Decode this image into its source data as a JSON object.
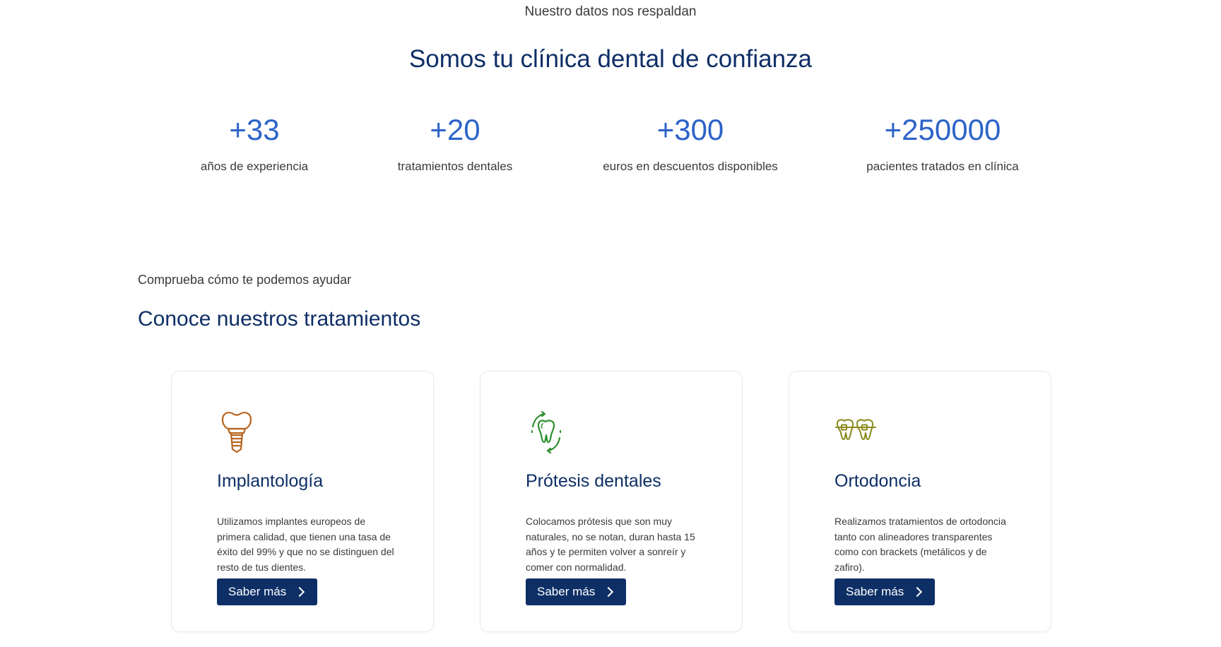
{
  "stats": {
    "eyebrow": "Nuestro datos nos respaldan",
    "title": "Somos tu clínica dental de confianza",
    "items": [
      {
        "value": "+33",
        "label": "años de experiencia"
      },
      {
        "value": "+20",
        "label": "tratamientos dentales"
      },
      {
        "value": "+300",
        "label": "euros en descuentos disponibles"
      },
      {
        "value": "+250000",
        "label": "pacientes tratados en clínica"
      }
    ]
  },
  "treatments": {
    "eyebrow": "Comprueba cómo te podemos ayudar",
    "title": "Conoce nuestros tratamientos",
    "cards": [
      {
        "icon": "dental-implant-icon",
        "icon_color": "#b8641e",
        "title": "Implantología",
        "description": "Utilizamos implantes europeos de primera calidad, que tienen una tasa de éxito del 99% y que no se distinguen del resto de tus dientes.",
        "button": "Saber más"
      },
      {
        "icon": "tooth-prosthesis-icon",
        "icon_color": "#2f8f2f",
        "title": "Prótesis dentales",
        "description": "Colocamos prótesis que son muy naturales, no se notan, duran hasta 15 años y te permiten volver a sonreír y comer con normalidad.",
        "button": "Saber más"
      },
      {
        "icon": "braces-teeth-icon",
        "icon_color": "#8a8a1c",
        "title": "Ortodoncia",
        "description": "Realizamos tratamientos de ortodoncia tanto con alineadores transparentes como con brackets (metálicos y de zafiro).",
        "button": "Saber más"
      }
    ]
  },
  "colors": {
    "primary": "#0e2f66",
    "accent": "#2d63c8",
    "text": "#3a3a3a"
  }
}
